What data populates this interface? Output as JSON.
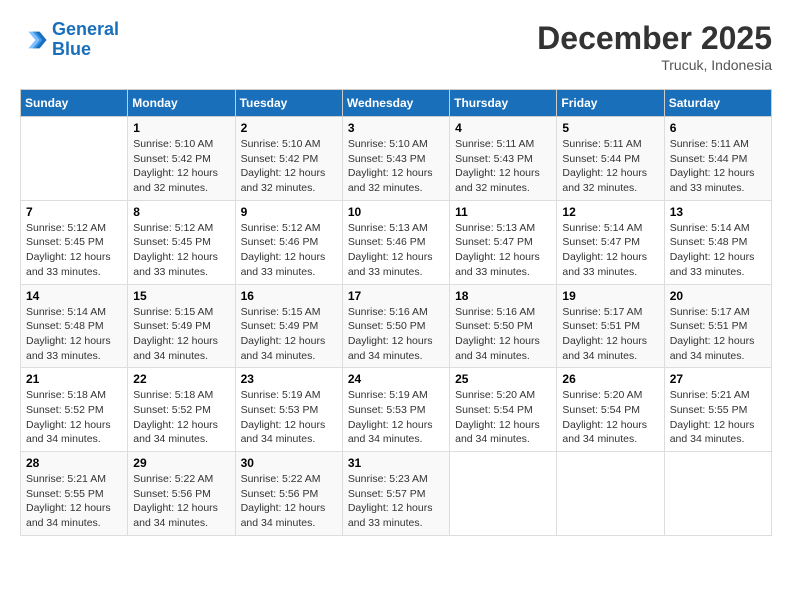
{
  "header": {
    "logo_line1": "General",
    "logo_line2": "Blue",
    "title": "December 2025",
    "subtitle": "Trucuk, Indonesia"
  },
  "weekdays": [
    "Sunday",
    "Monday",
    "Tuesday",
    "Wednesday",
    "Thursday",
    "Friday",
    "Saturday"
  ],
  "weeks": [
    [
      {
        "day": "",
        "info": ""
      },
      {
        "day": "1",
        "info": "Sunrise: 5:10 AM\nSunset: 5:42 PM\nDaylight: 12 hours\nand 32 minutes."
      },
      {
        "day": "2",
        "info": "Sunrise: 5:10 AM\nSunset: 5:42 PM\nDaylight: 12 hours\nand 32 minutes."
      },
      {
        "day": "3",
        "info": "Sunrise: 5:10 AM\nSunset: 5:43 PM\nDaylight: 12 hours\nand 32 minutes."
      },
      {
        "day": "4",
        "info": "Sunrise: 5:11 AM\nSunset: 5:43 PM\nDaylight: 12 hours\nand 32 minutes."
      },
      {
        "day": "5",
        "info": "Sunrise: 5:11 AM\nSunset: 5:44 PM\nDaylight: 12 hours\nand 32 minutes."
      },
      {
        "day": "6",
        "info": "Sunrise: 5:11 AM\nSunset: 5:44 PM\nDaylight: 12 hours\nand 33 minutes."
      }
    ],
    [
      {
        "day": "7",
        "info": "Sunrise: 5:12 AM\nSunset: 5:45 PM\nDaylight: 12 hours\nand 33 minutes."
      },
      {
        "day": "8",
        "info": "Sunrise: 5:12 AM\nSunset: 5:45 PM\nDaylight: 12 hours\nand 33 minutes."
      },
      {
        "day": "9",
        "info": "Sunrise: 5:12 AM\nSunset: 5:46 PM\nDaylight: 12 hours\nand 33 minutes."
      },
      {
        "day": "10",
        "info": "Sunrise: 5:13 AM\nSunset: 5:46 PM\nDaylight: 12 hours\nand 33 minutes."
      },
      {
        "day": "11",
        "info": "Sunrise: 5:13 AM\nSunset: 5:47 PM\nDaylight: 12 hours\nand 33 minutes."
      },
      {
        "day": "12",
        "info": "Sunrise: 5:14 AM\nSunset: 5:47 PM\nDaylight: 12 hours\nand 33 minutes."
      },
      {
        "day": "13",
        "info": "Sunrise: 5:14 AM\nSunset: 5:48 PM\nDaylight: 12 hours\nand 33 minutes."
      }
    ],
    [
      {
        "day": "14",
        "info": "Sunrise: 5:14 AM\nSunset: 5:48 PM\nDaylight: 12 hours\nand 33 minutes."
      },
      {
        "day": "15",
        "info": "Sunrise: 5:15 AM\nSunset: 5:49 PM\nDaylight: 12 hours\nand 34 minutes."
      },
      {
        "day": "16",
        "info": "Sunrise: 5:15 AM\nSunset: 5:49 PM\nDaylight: 12 hours\nand 34 minutes."
      },
      {
        "day": "17",
        "info": "Sunrise: 5:16 AM\nSunset: 5:50 PM\nDaylight: 12 hours\nand 34 minutes."
      },
      {
        "day": "18",
        "info": "Sunrise: 5:16 AM\nSunset: 5:50 PM\nDaylight: 12 hours\nand 34 minutes."
      },
      {
        "day": "19",
        "info": "Sunrise: 5:17 AM\nSunset: 5:51 PM\nDaylight: 12 hours\nand 34 minutes."
      },
      {
        "day": "20",
        "info": "Sunrise: 5:17 AM\nSunset: 5:51 PM\nDaylight: 12 hours\nand 34 minutes."
      }
    ],
    [
      {
        "day": "21",
        "info": "Sunrise: 5:18 AM\nSunset: 5:52 PM\nDaylight: 12 hours\nand 34 minutes."
      },
      {
        "day": "22",
        "info": "Sunrise: 5:18 AM\nSunset: 5:52 PM\nDaylight: 12 hours\nand 34 minutes."
      },
      {
        "day": "23",
        "info": "Sunrise: 5:19 AM\nSunset: 5:53 PM\nDaylight: 12 hours\nand 34 minutes."
      },
      {
        "day": "24",
        "info": "Sunrise: 5:19 AM\nSunset: 5:53 PM\nDaylight: 12 hours\nand 34 minutes."
      },
      {
        "day": "25",
        "info": "Sunrise: 5:20 AM\nSunset: 5:54 PM\nDaylight: 12 hours\nand 34 minutes."
      },
      {
        "day": "26",
        "info": "Sunrise: 5:20 AM\nSunset: 5:54 PM\nDaylight: 12 hours\nand 34 minutes."
      },
      {
        "day": "27",
        "info": "Sunrise: 5:21 AM\nSunset: 5:55 PM\nDaylight: 12 hours\nand 34 minutes."
      }
    ],
    [
      {
        "day": "28",
        "info": "Sunrise: 5:21 AM\nSunset: 5:55 PM\nDaylight: 12 hours\nand 34 minutes."
      },
      {
        "day": "29",
        "info": "Sunrise: 5:22 AM\nSunset: 5:56 PM\nDaylight: 12 hours\nand 34 minutes."
      },
      {
        "day": "30",
        "info": "Sunrise: 5:22 AM\nSunset: 5:56 PM\nDaylight: 12 hours\nand 34 minutes."
      },
      {
        "day": "31",
        "info": "Sunrise: 5:23 AM\nSunset: 5:57 PM\nDaylight: 12 hours\nand 33 minutes."
      },
      {
        "day": "",
        "info": ""
      },
      {
        "day": "",
        "info": ""
      },
      {
        "day": "",
        "info": ""
      }
    ]
  ]
}
